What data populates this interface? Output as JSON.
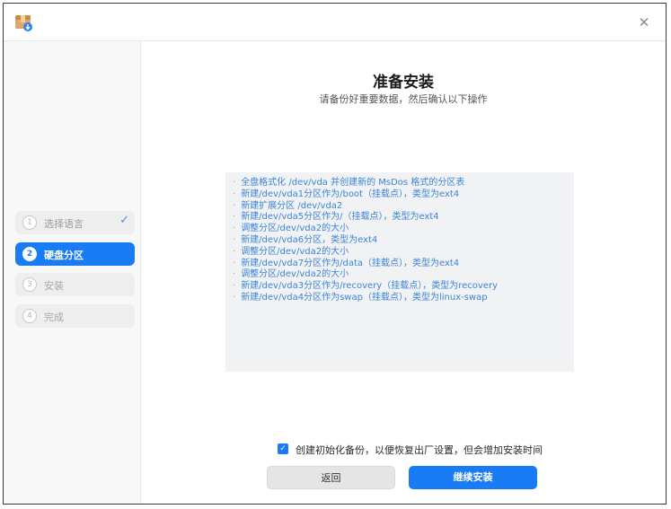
{
  "window": {
    "app_icon": "package-installer-icon",
    "close_icon": "close-icon",
    "close_glyph": "✕"
  },
  "sidebar": {
    "steps": [
      {
        "number": "1",
        "label": "选择语言",
        "state": "done",
        "check": "✓"
      },
      {
        "number": "2",
        "label": "硬盘分区",
        "state": "active"
      },
      {
        "number": "3",
        "label": "安装",
        "state": "pending"
      },
      {
        "number": "4",
        "label": "完成",
        "state": "pending"
      }
    ]
  },
  "main": {
    "title": "准备安装",
    "subtitle": "请备份好重要数据，然后确认以下操作",
    "operations": [
      "全盘格式化 /dev/vda 并创建新的 MsDos 格式的分区表",
      "新建/dev/vda1分区作为/boot（挂载点），类型为ext4",
      "新建扩展分区 /dev/vda2",
      "新建/dev/vda5分区作为/（挂载点），类型为ext4",
      "调整分区/dev/vda2的大小",
      "新建/dev/vda6分区，类型为ext4",
      "调整分区/dev/vda2的大小",
      "新建/dev/vda7分区作为/data（挂载点），类型为ext4",
      "调整分区/dev/vda2的大小",
      "新建/dev/vda3分区作为/recovery（挂载点），类型为recovery",
      "新建/dev/vda4分区作为swap（挂载点），类型为linux-swap"
    ],
    "bullet": "·",
    "backup_checkbox": {
      "checked": true,
      "label": "创建初始化备份，以便恢复出厂设置，但会增加安装时间"
    },
    "back_button": "返回",
    "next_button": "继续安装"
  },
  "colors": {
    "accent": "#1a7cf5",
    "operation_text": "#3d84d6"
  }
}
